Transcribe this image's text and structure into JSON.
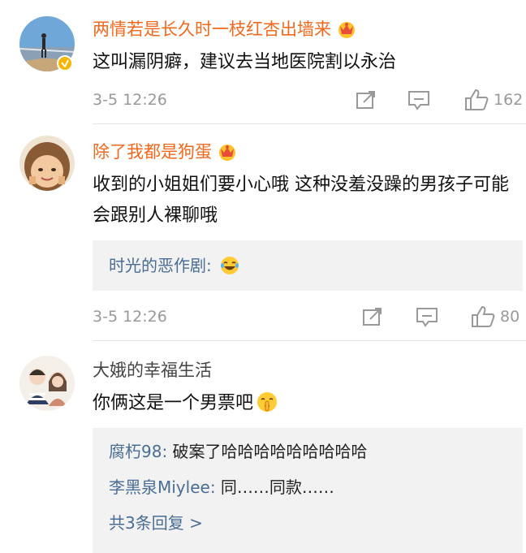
{
  "comments": [
    {
      "name": "两情若是长久时一枝红杏出墙来",
      "text": "这叫漏阴癖，建议去当地医院割以永治",
      "time": "3-5 12:26",
      "likes": "162",
      "icons": [
        "share-icon",
        "comment-icon",
        "like-icon",
        "crown-icon",
        "verified-badge-icon"
      ]
    },
    {
      "name": "除了我都是狗蛋",
      "text": "收到的小姐姐们要小心哦 这种没羞没躁的男孩子可能会跟别人裸聊哦",
      "replies": [
        {
          "user": "时光的恶作剧:",
          "text": "",
          "emoji": "laughing-tears-emoji"
        }
      ],
      "time": "3-5 12:26",
      "likes": "80"
    },
    {
      "name": "大娥的幸福生活",
      "text": "你俩这是一个男票吧",
      "text_emoji": "shush-emoji",
      "replies": [
        {
          "user": "腐朽98:",
          "text": "破案了哈哈哈哈哈哈哈哈哈"
        },
        {
          "user": "李黑泉Miylee:",
          "text": "同……同款……"
        }
      ],
      "more_replies": "共3条回复 >"
    }
  ],
  "colors": {
    "name_orange": "#f0691d",
    "reply_user_blue": "#4a6d95",
    "meta_gray": "#999999",
    "reply_bg": "#f2f2f2",
    "verified_badge": "#f7b500"
  }
}
